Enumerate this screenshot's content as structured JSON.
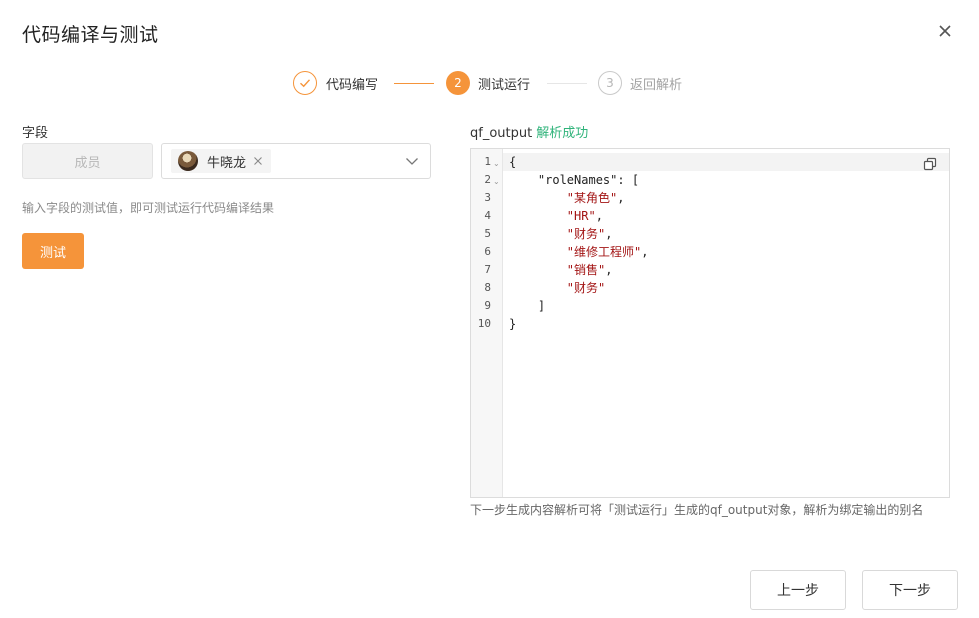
{
  "dialog": {
    "title": "代码编译与测试"
  },
  "steps": [
    {
      "label": "代码编写",
      "number": "",
      "status": "done"
    },
    {
      "label": "测试运行",
      "number": "2",
      "status": "active"
    },
    {
      "label": "返回解析",
      "number": "3",
      "status": "pending"
    }
  ],
  "field": {
    "label": "字段",
    "type_placeholder": "成员",
    "selected_member": "牛晓龙",
    "hint": "输入字段的测试值，即可测试运行代码编译结果"
  },
  "test_button_label": "测试",
  "output": {
    "name": "qf_output",
    "status": "解析成功",
    "lines": [
      {
        "num": "1",
        "fold": true
      },
      {
        "num": "2",
        "fold": true
      },
      {
        "num": "3",
        "fold": false
      },
      {
        "num": "4",
        "fold": false
      },
      {
        "num": "5",
        "fold": false
      },
      {
        "num": "6",
        "fold": false
      },
      {
        "num": "7",
        "fold": false
      },
      {
        "num": "8",
        "fold": false
      },
      {
        "num": "9",
        "fold": false
      },
      {
        "num": "10",
        "fold": false
      }
    ],
    "code": {
      "open_brace": "{",
      "key": "\"roleNames\"",
      "colon_bracket": ": [",
      "values": [
        "\"某角色\"",
        "\"HR\"",
        "\"财务\"",
        "\"维修工程师\"",
        "\"销售\"",
        "\"财务\""
      ],
      "close_bracket": "]",
      "close_brace": "}"
    },
    "note": "下一步生成内容解析可将「测试运行」生成的qf_output对象，解析为绑定输出的别名"
  },
  "footer": {
    "prev_label": "上一步",
    "next_label": "下一步"
  },
  "colors": {
    "accent": "#f5943a",
    "success": "#2fb37a",
    "string": "#a31515"
  }
}
